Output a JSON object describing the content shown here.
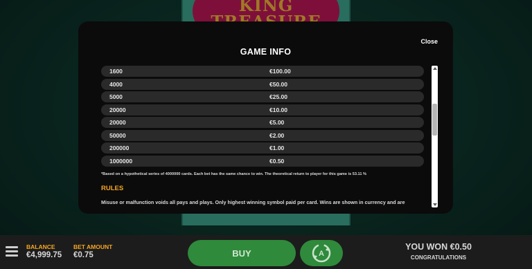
{
  "game": {
    "logo_text": "KING\nTREASURE"
  },
  "modal": {
    "title": "GAME INFO",
    "close_label": "Close",
    "paytable": [
      {
        "count": "1600",
        "amount": "€100.00"
      },
      {
        "count": "4000",
        "amount": "€50.00"
      },
      {
        "count": "5000",
        "amount": "€25.00"
      },
      {
        "count": "20000",
        "amount": "€10.00"
      },
      {
        "count": "20000",
        "amount": "€5.00"
      },
      {
        "count": "50000",
        "amount": "€2.00"
      },
      {
        "count": "200000",
        "amount": "€1.00"
      },
      {
        "count": "1000000",
        "amount": "€0.50"
      }
    ],
    "footnote": "*Based on a hypothetical series of 4000000 cards. Each bet has the same chance to win. The theoretical return to player for this game is 53.11 %",
    "rules_heading": "RULES",
    "rules_text": "Misuse or malfunction voids all pays and plays. Only highest winning symbol paid per card. Wins are shown in currency and are"
  },
  "bottom_bar": {
    "balance_label": "BALANCE",
    "balance_value": "€4,999.75",
    "bet_label": "BET AMOUNT",
    "bet_value": "€0.75",
    "buy_label": "BUY",
    "won_text": "YOU WON €0.50",
    "congrats_text": "CONGRATULATIONS"
  },
  "colors": {
    "accent": "#f6a623",
    "button_green": "#2f8a3b",
    "modal_bg": "#0b0b0b",
    "row_bg": "#2a2a2a"
  }
}
